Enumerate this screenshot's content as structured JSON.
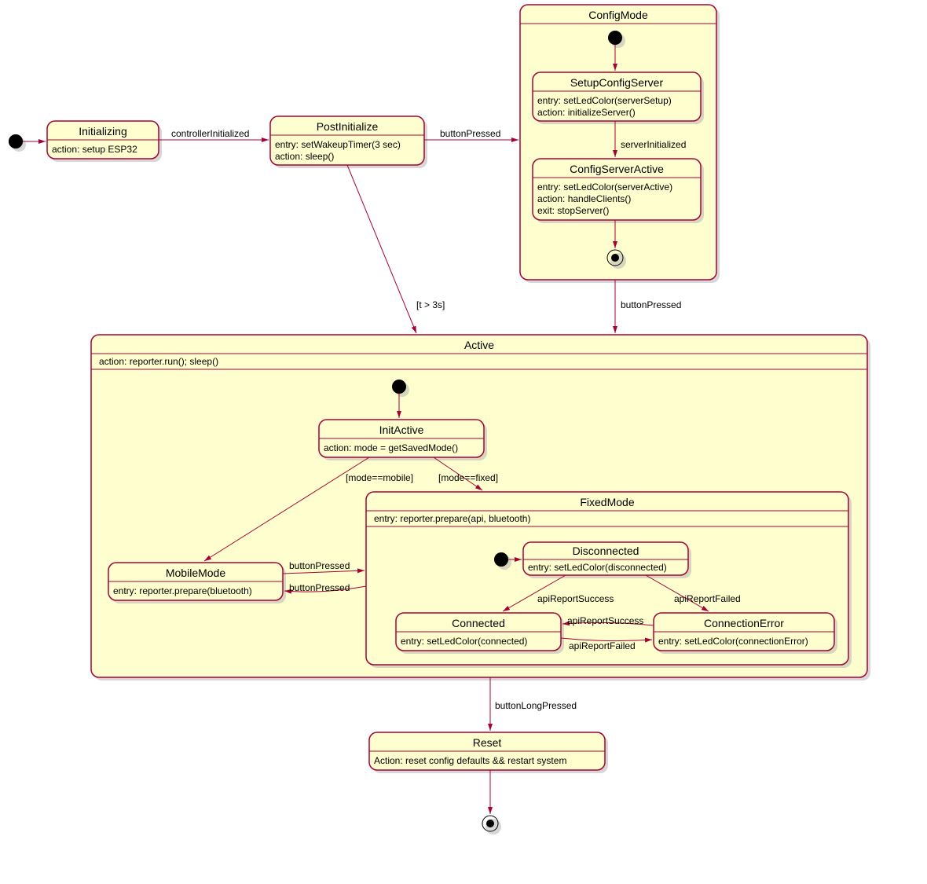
{
  "chart_data": {
    "type": "state_diagram",
    "states": [
      {
        "id": "Initializing",
        "name": "Initializing",
        "actions": [
          "action: setup ESP32"
        ]
      },
      {
        "id": "PostInitialize",
        "name": "PostInitialize",
        "actions": [
          "entry: setWakeupTimer(3 sec)",
          "action: sleep()"
        ]
      },
      {
        "id": "ConfigMode",
        "name": "ConfigMode",
        "composite": true,
        "substates": [
          {
            "id": "SetupConfigServer",
            "name": "SetupConfigServer",
            "actions": [
              "entry: setLedColor(serverSetup)",
              "action: initializeServer()"
            ]
          },
          {
            "id": "ConfigServerActive",
            "name": "ConfigServerActive",
            "actions": [
              "entry: setLedColor(serverActive)",
              "action: handleClients()",
              "exit: stopServer()"
            ]
          }
        ]
      },
      {
        "id": "Active",
        "name": "Active",
        "actions": [
          "action: reporter.run(); sleep()"
        ],
        "composite": true,
        "substates": [
          {
            "id": "InitActive",
            "name": "InitActive",
            "actions": [
              "action: mode = getSavedMode()"
            ]
          },
          {
            "id": "MobileMode",
            "name": "MobileMode",
            "actions": [
              "entry: reporter.prepare(bluetooth)"
            ]
          },
          {
            "id": "FixedMode",
            "name": "FixedMode",
            "actions": [
              "entry: reporter.prepare(api, bluetooth)"
            ],
            "composite": true,
            "substates": [
              {
                "id": "Disconnected",
                "name": "Disconnected",
                "actions": [
                  "entry: setLedColor(disconnected)"
                ]
              },
              {
                "id": "Connected",
                "name": "Connected",
                "actions": [
                  "entry: setLedColor(connected)"
                ]
              },
              {
                "id": "ConnectionError",
                "name": "ConnectionError",
                "actions": [
                  "entry: setLedColor(connectionError)"
                ]
              }
            ]
          }
        ]
      },
      {
        "id": "Reset",
        "name": "Reset",
        "actions": [
          "Action: reset config defaults && restart system"
        ]
      }
    ],
    "transitions": [
      {
        "from": "initial",
        "to": "Initializing",
        "label": ""
      },
      {
        "from": "Initializing",
        "to": "PostInitialize",
        "label": "controllerInitialized"
      },
      {
        "from": "PostInitialize",
        "to": "ConfigMode",
        "label": "buttonPressed"
      },
      {
        "from": "PostInitialize",
        "to": "Active",
        "label": "[t > 3s]"
      },
      {
        "from": "ConfigMode",
        "to": "Active",
        "label": "buttonPressed"
      },
      {
        "from": "ConfigMode.initial",
        "to": "SetupConfigServer",
        "label": ""
      },
      {
        "from": "SetupConfigServer",
        "to": "ConfigServerActive",
        "label": "serverInitialized"
      },
      {
        "from": "ConfigServerActive",
        "to": "ConfigMode.final",
        "label": ""
      },
      {
        "from": "Active.initial",
        "to": "InitActive",
        "label": ""
      },
      {
        "from": "InitActive",
        "to": "MobileMode",
        "label": "[mode==mobile]"
      },
      {
        "from": "InitActive",
        "to": "FixedMode",
        "label": "[mode==fixed]"
      },
      {
        "from": "MobileMode",
        "to": "FixedMode",
        "label": "buttonPressed"
      },
      {
        "from": "FixedMode",
        "to": "MobileMode",
        "label": "buttonPressed"
      },
      {
        "from": "FixedMode.initial",
        "to": "Disconnected",
        "label": ""
      },
      {
        "from": "Disconnected",
        "to": "Connected",
        "label": "apiReportSuccess"
      },
      {
        "from": "Disconnected",
        "to": "ConnectionError",
        "label": "apiReportFailed"
      },
      {
        "from": "ConnectionError",
        "to": "Connected",
        "label": "apiReportSuccess"
      },
      {
        "from": "Connected",
        "to": "ConnectionError",
        "label": "apiReportFailed"
      },
      {
        "from": "Active",
        "to": "Reset",
        "label": "buttonLongPressed"
      },
      {
        "from": "Reset",
        "to": "final",
        "label": ""
      }
    ]
  },
  "states": {
    "initializing": {
      "name": "Initializing",
      "l1": "action: setup ESP32"
    },
    "postinit": {
      "name": "PostInitialize",
      "l1": "entry: setWakeupTimer(3 sec)",
      "l2": "action: sleep()"
    },
    "configmode": {
      "name": "ConfigMode"
    },
    "setupconfig": {
      "name": "SetupConfigServer",
      "l1": "entry: setLedColor(serverSetup)",
      "l2": "action: initializeServer()"
    },
    "configactive": {
      "name": "ConfigServerActive",
      "l1": "entry: setLedColor(serverActive)",
      "l2": "action: handleClients()",
      "l3": "exit: stopServer()"
    },
    "active": {
      "name": "Active",
      "l1": "action: reporter.run(); sleep()"
    },
    "initactive": {
      "name": "InitActive",
      "l1": "action: mode = getSavedMode()"
    },
    "mobilemode": {
      "name": "MobileMode",
      "l1": "entry: reporter.prepare(bluetooth)"
    },
    "fixedmode": {
      "name": "FixedMode",
      "l1": "entry: reporter.prepare(api, bluetooth)"
    },
    "disconnected": {
      "name": "Disconnected",
      "l1": "entry: setLedColor(disconnected)"
    },
    "connected": {
      "name": "Connected",
      "l1": "entry: setLedColor(connected)"
    },
    "connerror": {
      "name": "ConnectionError",
      "l1": "entry: setLedColor(connectionError)"
    },
    "reset": {
      "name": "Reset",
      "l1": "Action: reset config defaults && restart system"
    }
  },
  "transitions": {
    "t1": "controllerInitialized",
    "t2": "buttonPressed",
    "t3": "[t > 3s]",
    "t4": "buttonPressed",
    "t5": "serverInitialized",
    "t6": "[mode==mobile]",
    "t7": "[mode==fixed]",
    "t8": "buttonPressed",
    "t9": "buttonPressed",
    "t10": "apiReportSuccess",
    "t11": "apiReportFailed",
    "t12": "apiReportSuccess",
    "t13": "apiReportFailed",
    "t14": "buttonLongPressed"
  }
}
